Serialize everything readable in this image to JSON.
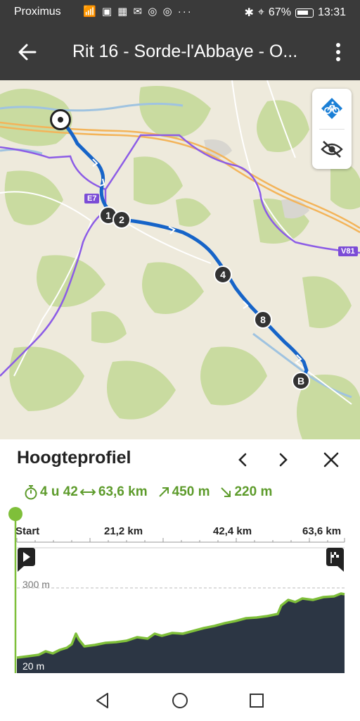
{
  "status_bar": {
    "carrier": "Proximus",
    "battery": "67%",
    "time": "13:31"
  },
  "app_bar": {
    "title": "Rit 16 - Sorde-l'Abbaye - O..."
  },
  "map": {
    "road_labels": [
      "E7",
      "V81"
    ],
    "waypoints": [
      "1",
      "2",
      "4",
      "8",
      "B"
    ]
  },
  "elevation": {
    "title": "Hoogteprofiel",
    "duration": "4 u 42",
    "distance": "63,6 km",
    "ascent": "450 m",
    "descent": "220 m",
    "axis_labels": [
      "Start",
      "21,2 km",
      "42,4 km",
      "63,6 km"
    ],
    "y_max_label": "300 m",
    "y_min_label": "20 m"
  },
  "colors": {
    "route": "#1664c8",
    "accent": "#6aa82e",
    "profile_fill": "#2c3644"
  }
}
